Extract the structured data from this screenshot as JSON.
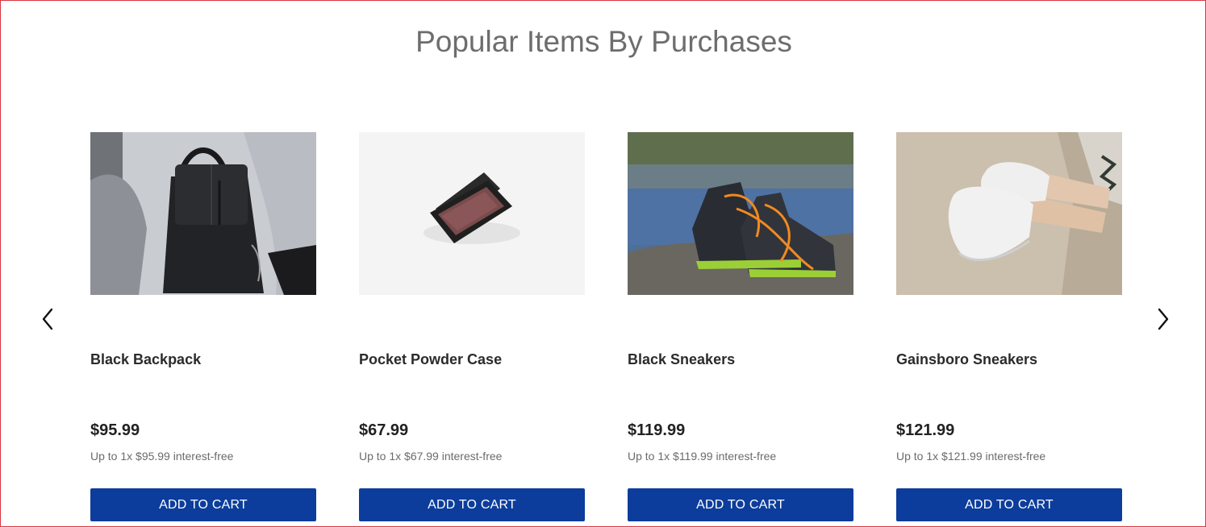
{
  "section": {
    "title": "Popular Items By Purchases"
  },
  "carousel": {
    "prev_icon": "chevron-left-icon",
    "next_icon": "chevron-right-icon"
  },
  "products": [
    {
      "name": "Black Backpack",
      "price": "$95.99",
      "installment": "Up to 1x $95.99 interest-free",
      "button_label": "ADD TO CART"
    },
    {
      "name": "Pocket Powder Case",
      "price": "$67.99",
      "installment": "Up to 1x $67.99 interest-free",
      "button_label": "ADD TO CART"
    },
    {
      "name": "Black Sneakers",
      "price": "$119.99",
      "installment": "Up to 1x $119.99 interest-free",
      "button_label": "ADD TO CART"
    },
    {
      "name": "Gainsboro Sneakers",
      "price": "$121.99",
      "installment": "Up to 1x $121.99 interest-free",
      "button_label": "ADD TO CART"
    }
  ],
  "colors": {
    "button_bg": "#0c3d9c",
    "button_text": "#ffffff",
    "title_text": "#6d6d6d",
    "frame_border": "#d9363e"
  }
}
